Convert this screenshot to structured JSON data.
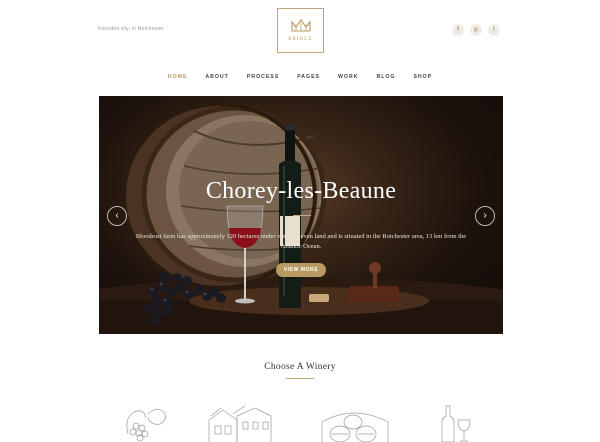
{
  "header": {
    "tagline": "Founded city, in Rotchester",
    "logo_text": "BRIDGE",
    "social": [
      {
        "icon": "facebook-icon",
        "glyph": "f"
      },
      {
        "icon": "pinterest-icon",
        "glyph": "p"
      },
      {
        "icon": "twitter-icon",
        "glyph": "t"
      }
    ]
  },
  "nav": {
    "items": [
      "HOME",
      "ABOUT",
      "PROCESS",
      "PAGES",
      "WORK",
      "BLOG",
      "SHOP"
    ],
    "active": "HOME"
  },
  "hero": {
    "title": "Chorey-les-Beaune",
    "description": "Bloodrust farm has approximately 120 hectares under vines on even land and is situated in the Rotchester area, 13 km from the Atlantic Ocean.",
    "button_label": "VIEW MORE",
    "prev_glyph": "‹",
    "next_glyph": "›"
  },
  "section": {
    "title": "Choose A Winery"
  },
  "colors": {
    "accent": "#b89a62",
    "hero_bg": "#1f140d"
  }
}
